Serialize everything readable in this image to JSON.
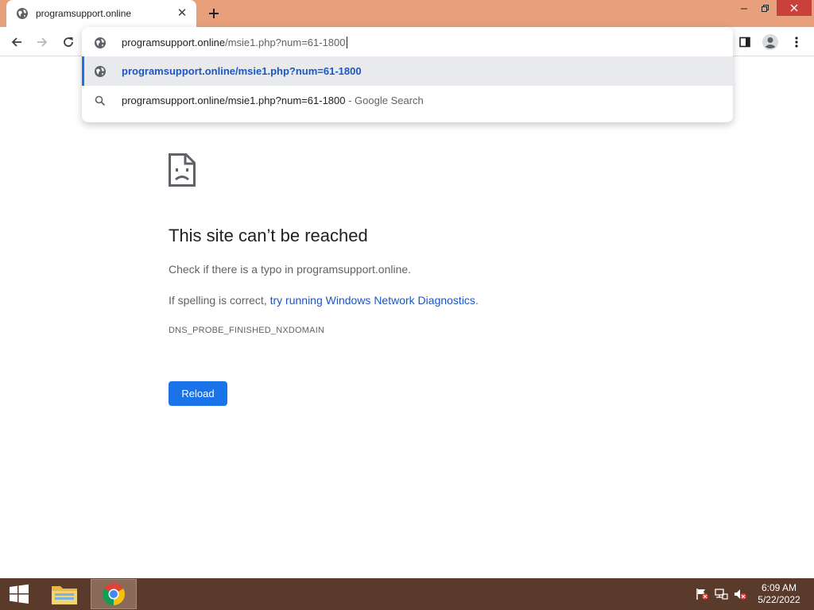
{
  "tab": {
    "title": "programsupport.online",
    "favicon": "globe-icon"
  },
  "omnibox": {
    "host": "programsupport.online",
    "path": "/msie1.php?num=61-1800",
    "suggestions": [
      {
        "text": "programsupport.online/msie1.php?num=61-1800",
        "icon": "globe-icon"
      },
      {
        "text": "programsupport.online/msie1.php?num=61-1800",
        "suffix": " - Google Search",
        "icon": "search-icon"
      }
    ]
  },
  "error": {
    "title": "This site can’t be reached",
    "line1": "Check if there is a typo in programsupport.online.",
    "line2_prefix": "If spelling is correct, ",
    "line2_link": "try running Windows Network Diagnostics",
    "line2_suffix": ".",
    "code": "DNS_PROBE_FINISHED_NXDOMAIN",
    "reload_label": "Reload"
  },
  "taskbar": {
    "time": "6:09 AM",
    "date": "5/22/2022"
  },
  "colors": {
    "titlebar": "#e8a07c",
    "accent": "#1a73e8",
    "link": "#1a56c8",
    "taskbar": "#5a3a2a"
  }
}
